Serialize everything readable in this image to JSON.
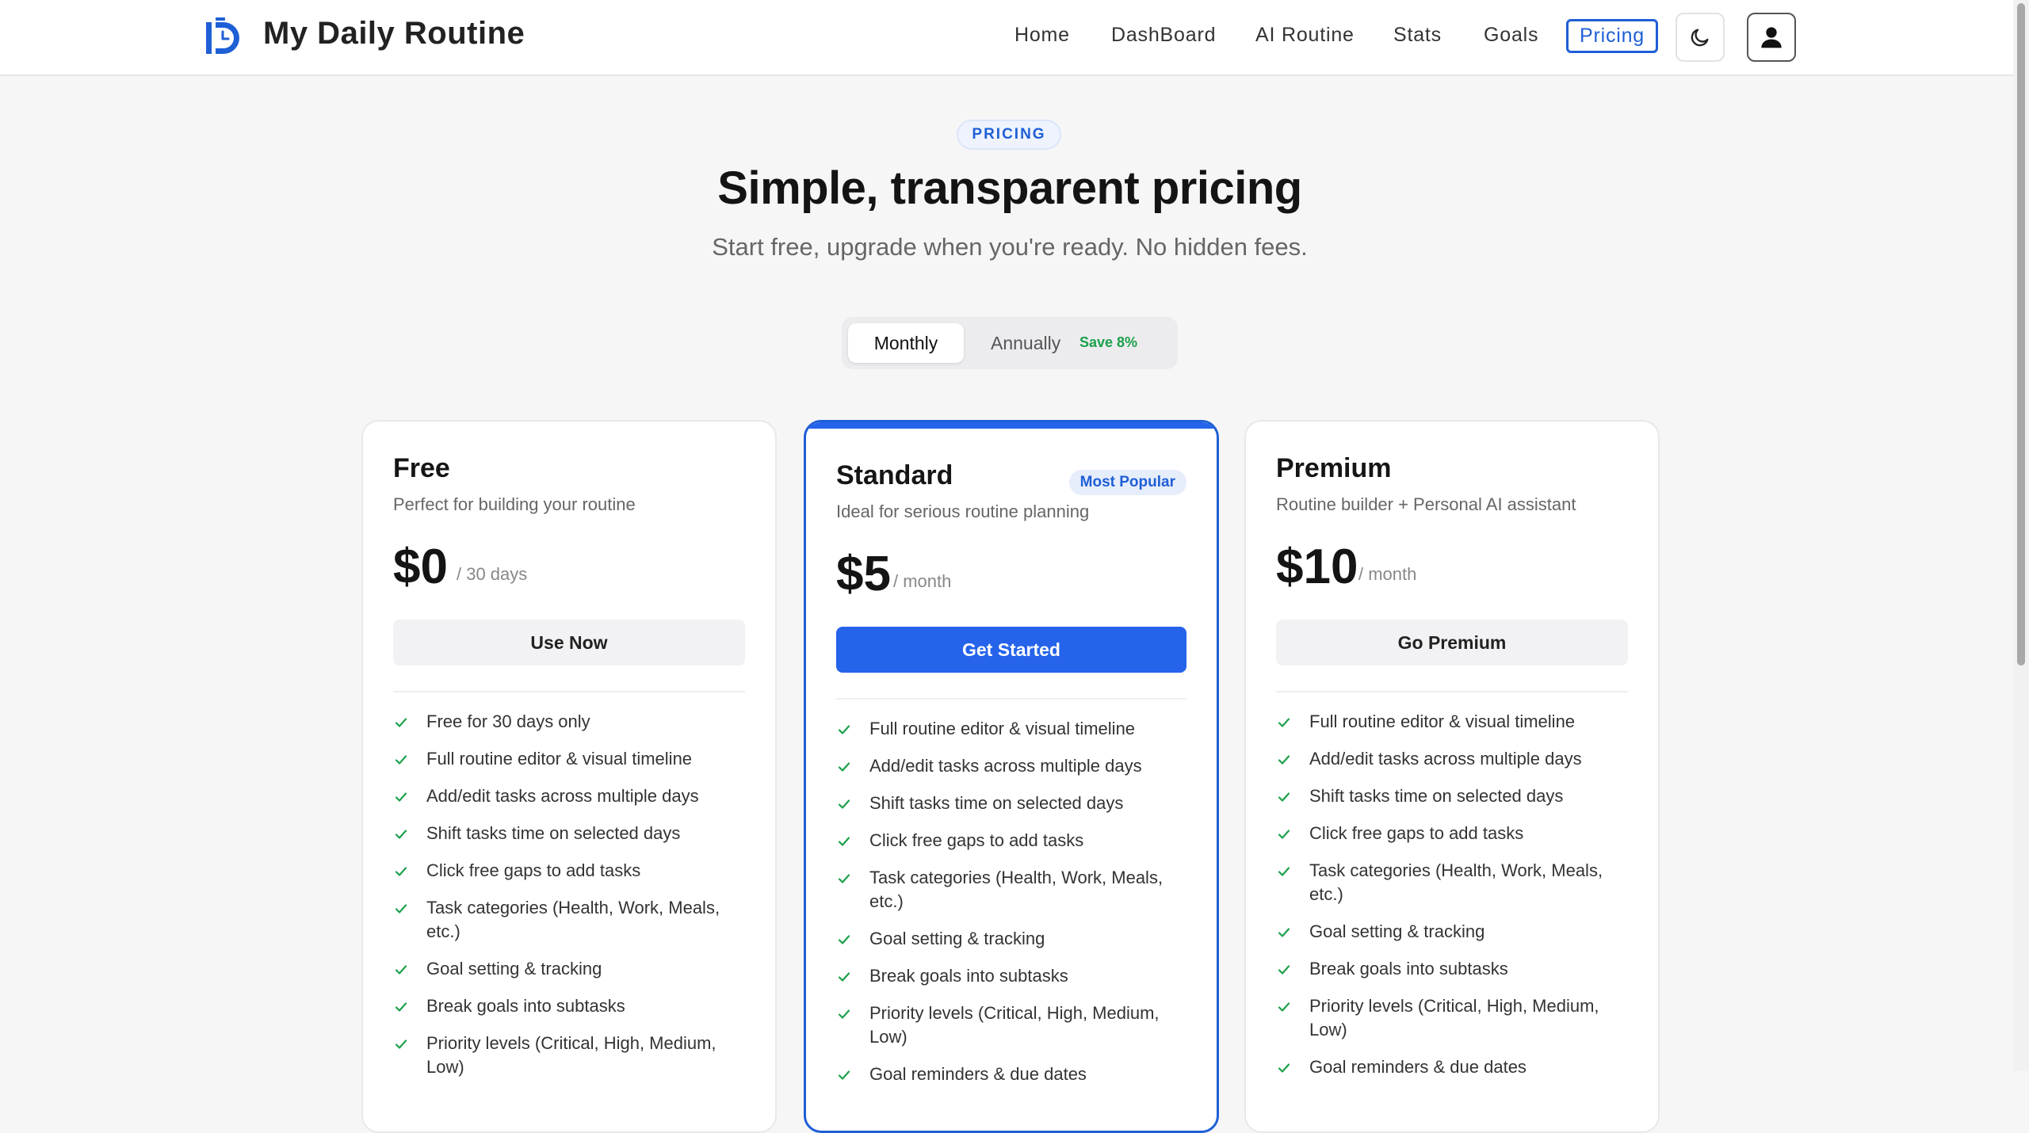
{
  "app": {
    "title": "My Daily Routine"
  },
  "nav": {
    "items": [
      "Home",
      "DashBoard",
      "AI Routine",
      "Stats",
      "Goals",
      "Pricing"
    ],
    "active": "Pricing",
    "theme_icon": "moon-icon",
    "user_icon": "user-icon"
  },
  "hero": {
    "badge": "PRICING",
    "title": "Simple, transparent pricing",
    "subtitle": "Start free, upgrade when you're ready. No hidden fees."
  },
  "billing_toggle": {
    "monthly": "Monthly",
    "annually": "Annually",
    "save": "Save 8%",
    "selected": "Monthly"
  },
  "colors": {
    "accent": "#2563eb",
    "check": "#1ca04b"
  },
  "plans": [
    {
      "name": "Free",
      "description": "Perfect for building your routine",
      "price": "$0",
      "period": "/ 30 days",
      "cta": "Use Now",
      "features": [
        "Free for 30 days only",
        "Full routine editor & visual timeline",
        "Add/edit tasks across multiple days",
        "Shift tasks time on selected days",
        "Click free gaps to add tasks",
        "Task categories (Health, Work, Meals, etc.)",
        "Goal setting & tracking",
        "Break goals into subtasks",
        "Priority levels (Critical, High, Medium, Low)"
      ]
    },
    {
      "name": "Standard",
      "badge": "Most Popular",
      "description": "Ideal for serious routine planning",
      "price": "$5",
      "period": "/ month",
      "cta": "Get Started",
      "features": [
        "Full routine editor & visual timeline",
        "Add/edit tasks across multiple days",
        "Shift tasks time on selected days",
        "Click free gaps to add tasks",
        "Task categories (Health, Work, Meals, etc.)",
        "Goal setting & tracking",
        "Break goals into subtasks",
        "Priority levels (Critical, High, Medium, Low)",
        "Goal reminders & due dates"
      ]
    },
    {
      "name": "Premium",
      "description": "Routine builder + Personal AI assistant",
      "price": "$10",
      "period": "/ month",
      "cta": "Go Premium",
      "features": [
        "Full routine editor & visual timeline",
        "Add/edit tasks across multiple days",
        "Shift tasks time on selected days",
        "Click free gaps to add tasks",
        "Task categories (Health, Work, Meals, etc.)",
        "Goal setting & tracking",
        "Break goals into subtasks",
        "Priority levels (Critical, High, Medium, Low)",
        "Goal reminders & due dates"
      ]
    }
  ]
}
